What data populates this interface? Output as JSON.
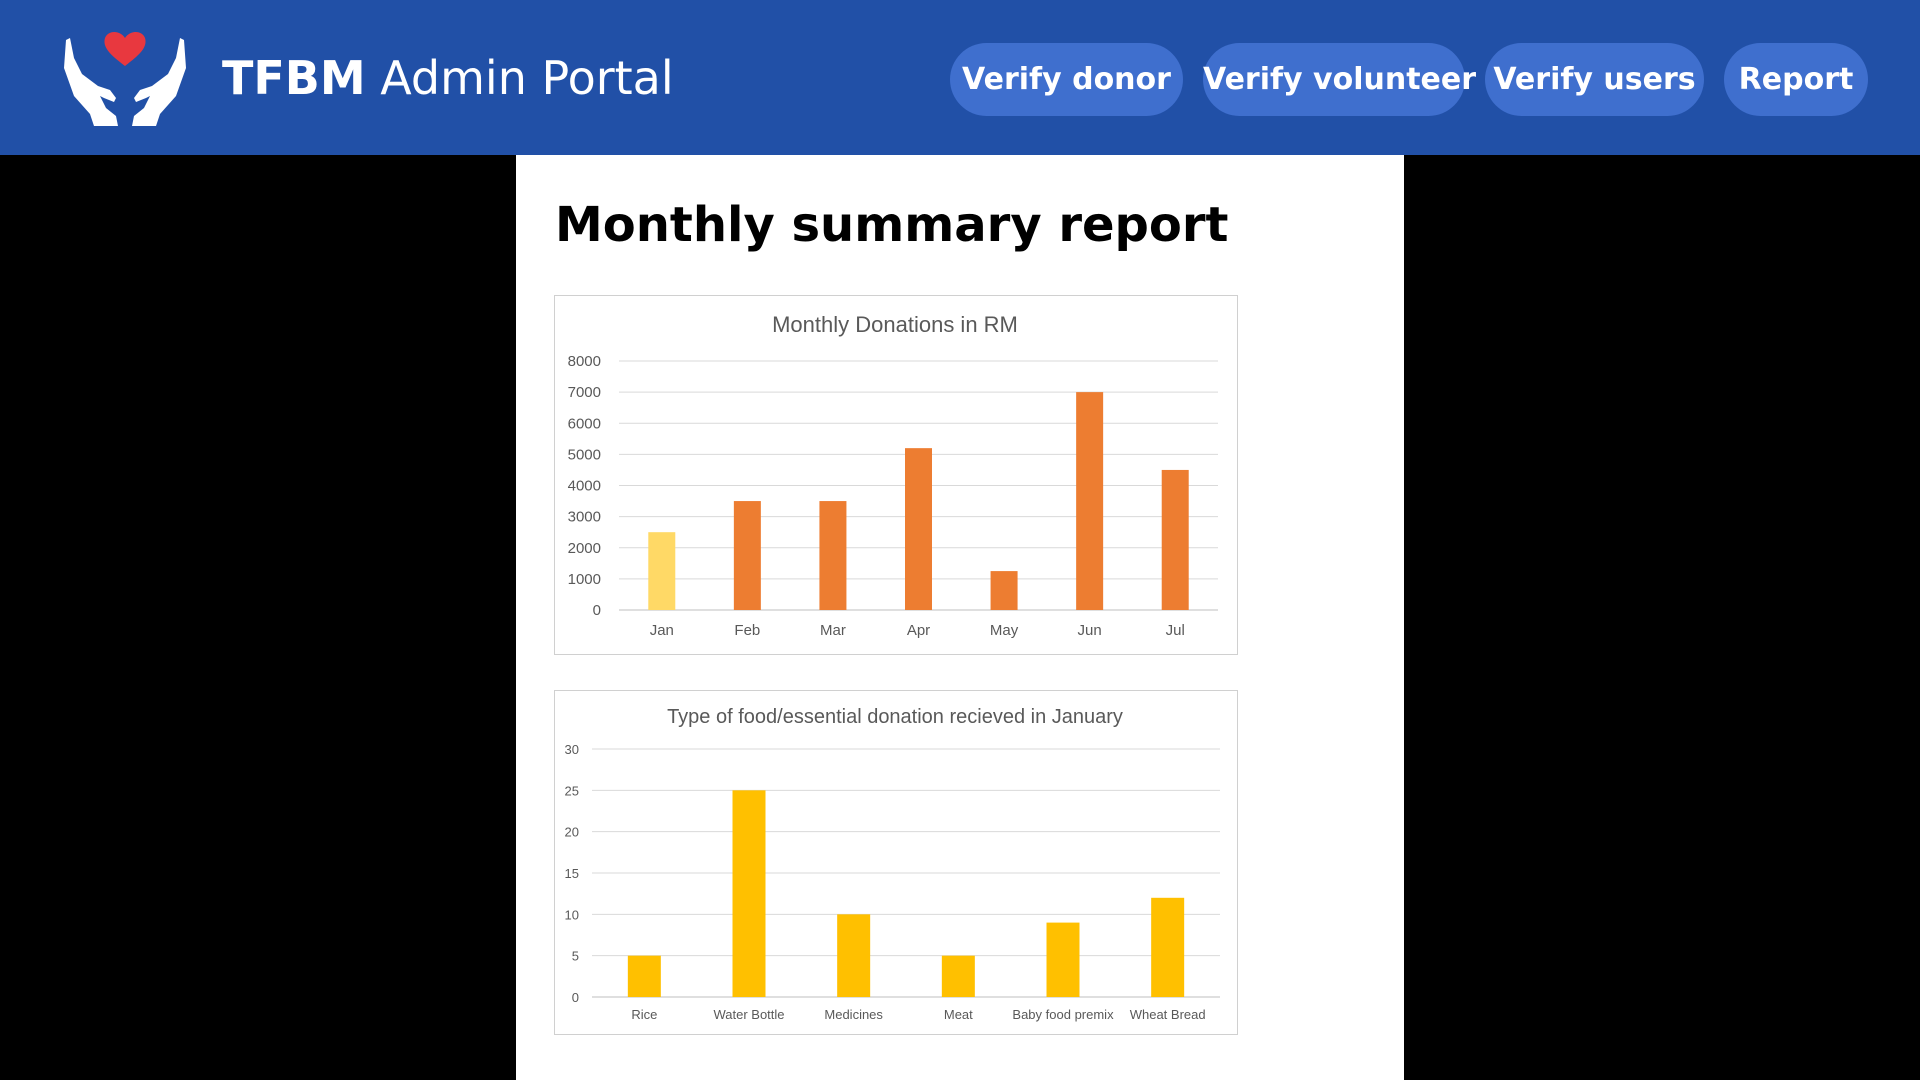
{
  "header": {
    "brand_bold": "TFBM",
    "brand_rest": "Admin Portal",
    "logo_icon": "hands-heart-icon",
    "background": "#2150a7",
    "button_color": "#3f6fce"
  },
  "nav": {
    "verify_donor": "Verify donor",
    "verify_volunteer": "Verify volunteer",
    "verify_users": "Verify users",
    "report": "Report"
  },
  "page": {
    "title": "Monthly summary report"
  },
  "chart_data": [
    {
      "type": "bar",
      "title": "Monthly Donations in RM",
      "categories": [
        "Jan",
        "Feb",
        "Mar",
        "Apr",
        "May",
        "Jun",
        "Jul"
      ],
      "values": [
        2500,
        3500,
        3500,
        5200,
        1250,
        7000,
        4500
      ],
      "bar_colors": [
        "#ffd966",
        "#ed7d31",
        "#ed7d31",
        "#ed7d31",
        "#ed7d31",
        "#ed7d31",
        "#ed7d31"
      ],
      "ylim": [
        0,
        8000
      ],
      "yticks": [
        0,
        1000,
        2000,
        3000,
        4000,
        5000,
        6000,
        7000,
        8000
      ],
      "grid": true,
      "xlabel": "",
      "ylabel": ""
    },
    {
      "type": "bar",
      "title": "Type of food/essential donation recieved in January",
      "categories": [
        "Rice",
        "Water Bottle",
        "Medicines",
        "Meat",
        "Baby food premix",
        "Wheat Bread"
      ],
      "values": [
        5,
        25,
        10,
        5,
        9,
        12
      ],
      "bar_colors": [
        "#ffc000",
        "#ffc000",
        "#ffc000",
        "#ffc000",
        "#ffc000",
        "#ffc000"
      ],
      "ylim": [
        0,
        30
      ],
      "yticks": [
        0,
        5,
        10,
        15,
        20,
        25,
        30
      ],
      "grid": true,
      "xlabel": "",
      "ylabel": ""
    }
  ]
}
